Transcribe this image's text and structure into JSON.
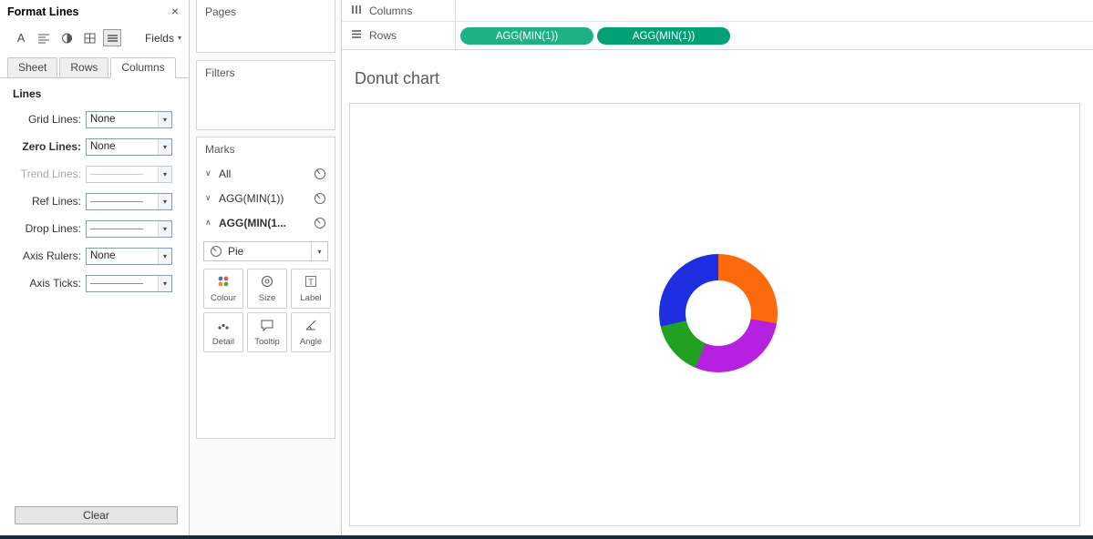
{
  "icons": {
    "font_glyph": "A",
    "close": "×",
    "dropdown_arrow": "▾",
    "chevron_down": "∨",
    "chevron_up": "∧"
  },
  "format_panel": {
    "title": "Format Lines",
    "fields_label": "Fields",
    "tabs": [
      {
        "label": "Sheet"
      },
      {
        "label": "Rows"
      },
      {
        "label": "Columns"
      }
    ],
    "active_tab": "Columns",
    "section_title": "Lines",
    "rows": [
      {
        "label": "Grid Lines:",
        "value": "None"
      },
      {
        "label": "Zero Lines:",
        "value": "None"
      },
      {
        "label": "Trend Lines:",
        "value": ""
      },
      {
        "label": "Ref Lines:",
        "value": ""
      },
      {
        "label": "Drop Lines:",
        "value": ""
      },
      {
        "label": "Axis Rulers:",
        "value": "None"
      },
      {
        "label": "Axis Ticks:",
        "value": ""
      }
    ],
    "clear_button": "Clear"
  },
  "cards": {
    "pages_label": "Pages",
    "filters_label": "Filters",
    "marks": {
      "title": "Marks",
      "layers": [
        {
          "label": "All",
          "expanded": false
        },
        {
          "label": "AGG(MIN(1))",
          "expanded": false
        },
        {
          "label": "AGG(MIN(1...",
          "expanded": true
        }
      ],
      "mark_type": "Pie",
      "buttons": [
        {
          "label": "Colour"
        },
        {
          "label": "Size"
        },
        {
          "label": "Label"
        },
        {
          "label": "Detail"
        },
        {
          "label": "Tooltip"
        },
        {
          "label": "Angle"
        }
      ]
    }
  },
  "shelves": {
    "columns_label": "Columns",
    "rows_label": "Rows",
    "pills": [
      {
        "label": "AGG(MIN(1))",
        "color": "#1db187"
      },
      {
        "label": "AGG(MIN(1))",
        "color": "#00a176"
      }
    ]
  },
  "sheet": {
    "title": "Donut chart"
  },
  "chart_data": {
    "type": "donut",
    "title": "Donut chart",
    "segments": [
      {
        "name": "orange",
        "color": "#fa6a0a",
        "start_deg": 0,
        "end_deg": 100
      },
      {
        "name": "magenta",
        "color": "#b620e0",
        "start_deg": 100,
        "end_deg": 203
      },
      {
        "name": "green",
        "color": "#21a121",
        "start_deg": 203,
        "end_deg": 257
      },
      {
        "name": "blue",
        "color": "#1f2ee0",
        "start_deg": 257,
        "end_deg": 360
      }
    ],
    "inner_radius_ratio": 0.55,
    "hole_color": "#ffffff",
    "legend": false,
    "grid": false
  }
}
